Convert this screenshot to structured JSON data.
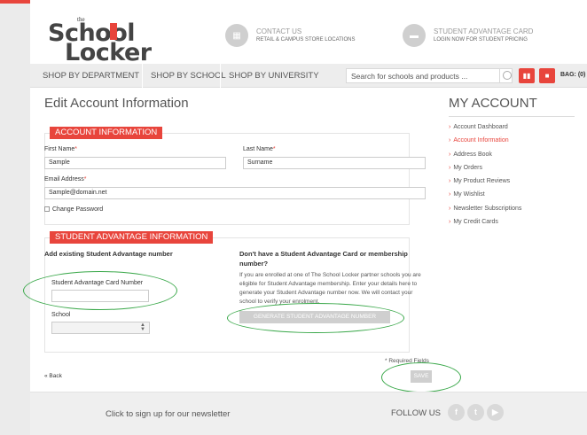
{
  "header": {
    "logo_the": "the",
    "logo_school": "School",
    "logo_locker": "Locker",
    "contact_title": "CONTACT US",
    "contact_sub": "RETAIL & CAMPUS STORE LOCATIONS",
    "sa_title": "STUDENT ADVANTAGE CARD",
    "sa_sub": "LOGIN NOW FOR STUDENT PRICING"
  },
  "nav": {
    "items": [
      "SHOP BY DEPARTMENT",
      "SHOP BY SCHOOL",
      "SHOP BY UNIVERSITY"
    ],
    "search_placeholder": "Search for schools and products ...",
    "bag_label": "BAG: (0)"
  },
  "main": {
    "title": "Edit Account Information",
    "account_section": {
      "title": "ACCOUNT INFORMATION",
      "first_name_label": "First Name",
      "first_name_value": "Sample",
      "last_name_label": "Last Name",
      "last_name_value": "Surname",
      "email_label": "Email Address",
      "email_value": "Sample@domain.net",
      "change_password_label": "Change Password",
      "required_marker": "*"
    },
    "student_section": {
      "title": "STUDENT ADVANTAGE INFORMATION",
      "add_existing_label": "Add existing Student Advantage number",
      "card_number_label": "Student Advantage Card Number",
      "card_number_value": "",
      "school_label": "School",
      "no_card_heading": "Don't have a Student Advantage Card or membership number?",
      "no_card_text": "If you are enrolled at one of The School Locker partner schools you are eligible for Student Advantage membership. Enter your details here to generate your Student Advantage number now. We will contact your school to verify your enrolment.",
      "generate_button": "GENERATE STUDENT ADVANTAGE NUMBER"
    },
    "required_fields": "* Required Fields",
    "save_button": "SAVE",
    "back_link": "« Back"
  },
  "sidebar": {
    "title": "MY ACCOUNT",
    "items": [
      {
        "label": "Account Dashboard",
        "active": false
      },
      {
        "label": "Account Information",
        "active": true
      },
      {
        "label": "Address Book",
        "active": false
      },
      {
        "label": "My Orders",
        "active": false
      },
      {
        "label": "My Product Reviews",
        "active": false
      },
      {
        "label": "My Wishlist",
        "active": false
      },
      {
        "label": "Newsletter Subscriptions",
        "active": false
      },
      {
        "label": "My Credit Cards",
        "active": false
      }
    ],
    "bullet": "›"
  },
  "footer": {
    "newsletter_text": "Click to sign up for our newsletter",
    "follow_label": "FOLLOW US",
    "social_icons": [
      "facebook-icon",
      "twitter-icon",
      "youtube-icon"
    ]
  },
  "colors": {
    "accent": "#e8453c",
    "annotation": "#3aa84a"
  }
}
